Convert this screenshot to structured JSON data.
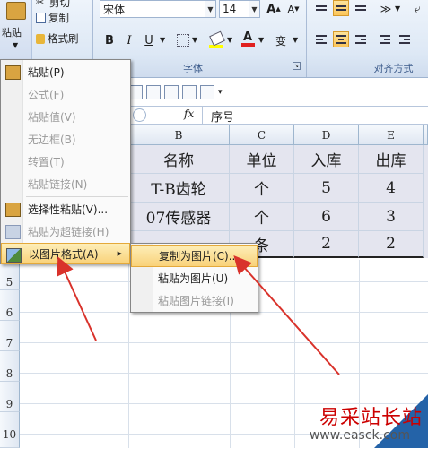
{
  "ribbon": {
    "clipboard": {
      "paste_label": "粘贴",
      "cut_label": "剪切",
      "copy_label": "复制",
      "format_painter_label": "格式刷"
    },
    "font": {
      "font_name": "宋体",
      "font_size": "14",
      "group_label": "字体",
      "bold": "B",
      "italic": "I",
      "underline": "U",
      "font_color_glyph": "A",
      "phonetic_glyph": "变"
    },
    "alignment": {
      "group_label": "对齐方式"
    }
  },
  "formula_bar": {
    "fx": "fx",
    "content": "序号"
  },
  "columns": [
    "B",
    "C",
    "D",
    "E"
  ],
  "rows": [
    {
      "num": "5"
    },
    {
      "num": "6"
    },
    {
      "num": "7"
    },
    {
      "num": "8"
    },
    {
      "num": "9"
    },
    {
      "num": "10"
    }
  ],
  "table": {
    "header": [
      "名称",
      "单位",
      "入库",
      "出库"
    ],
    "rows": [
      [
        "T-B齿轮",
        "个",
        "5",
        "4"
      ],
      [
        "07传感器",
        "个",
        "6",
        "3"
      ],
      [
        "",
        "条",
        "2",
        "2"
      ]
    ]
  },
  "paste_menu": [
    {
      "label": "粘贴(P)",
      "enabled": true,
      "icon": "paste-icon"
    },
    {
      "label": "公式(F)",
      "enabled": false
    },
    {
      "label": "粘贴值(V)",
      "enabled": false
    },
    {
      "label": "无边框(B)",
      "enabled": false
    },
    {
      "label": "转置(T)",
      "enabled": false
    },
    {
      "label": "粘贴链接(N)",
      "enabled": false
    },
    {
      "label": "选择性粘贴(V)...",
      "enabled": true,
      "icon": "paste-special-icon"
    },
    {
      "label": "粘贴为超链接(H)",
      "enabled": false,
      "icon": "hyperlink-icon"
    },
    {
      "label": "以图片格式(A)",
      "enabled": true,
      "icon": "picture-icon",
      "submenu_glyph": "▶"
    }
  ],
  "submenu": [
    {
      "label": "复制为图片(C)...",
      "enabled": true
    },
    {
      "label": "粘贴为图片(U)",
      "enabled": true
    },
    {
      "label": "粘贴图片链接(I)",
      "enabled": false
    }
  ],
  "watermark": {
    "title": "易采站长站",
    "url": "www.easck.com"
  },
  "colors": {
    "highlight": "#f9d27a",
    "arrow": "#d9322b",
    "ribbon": "#dde8f5"
  }
}
